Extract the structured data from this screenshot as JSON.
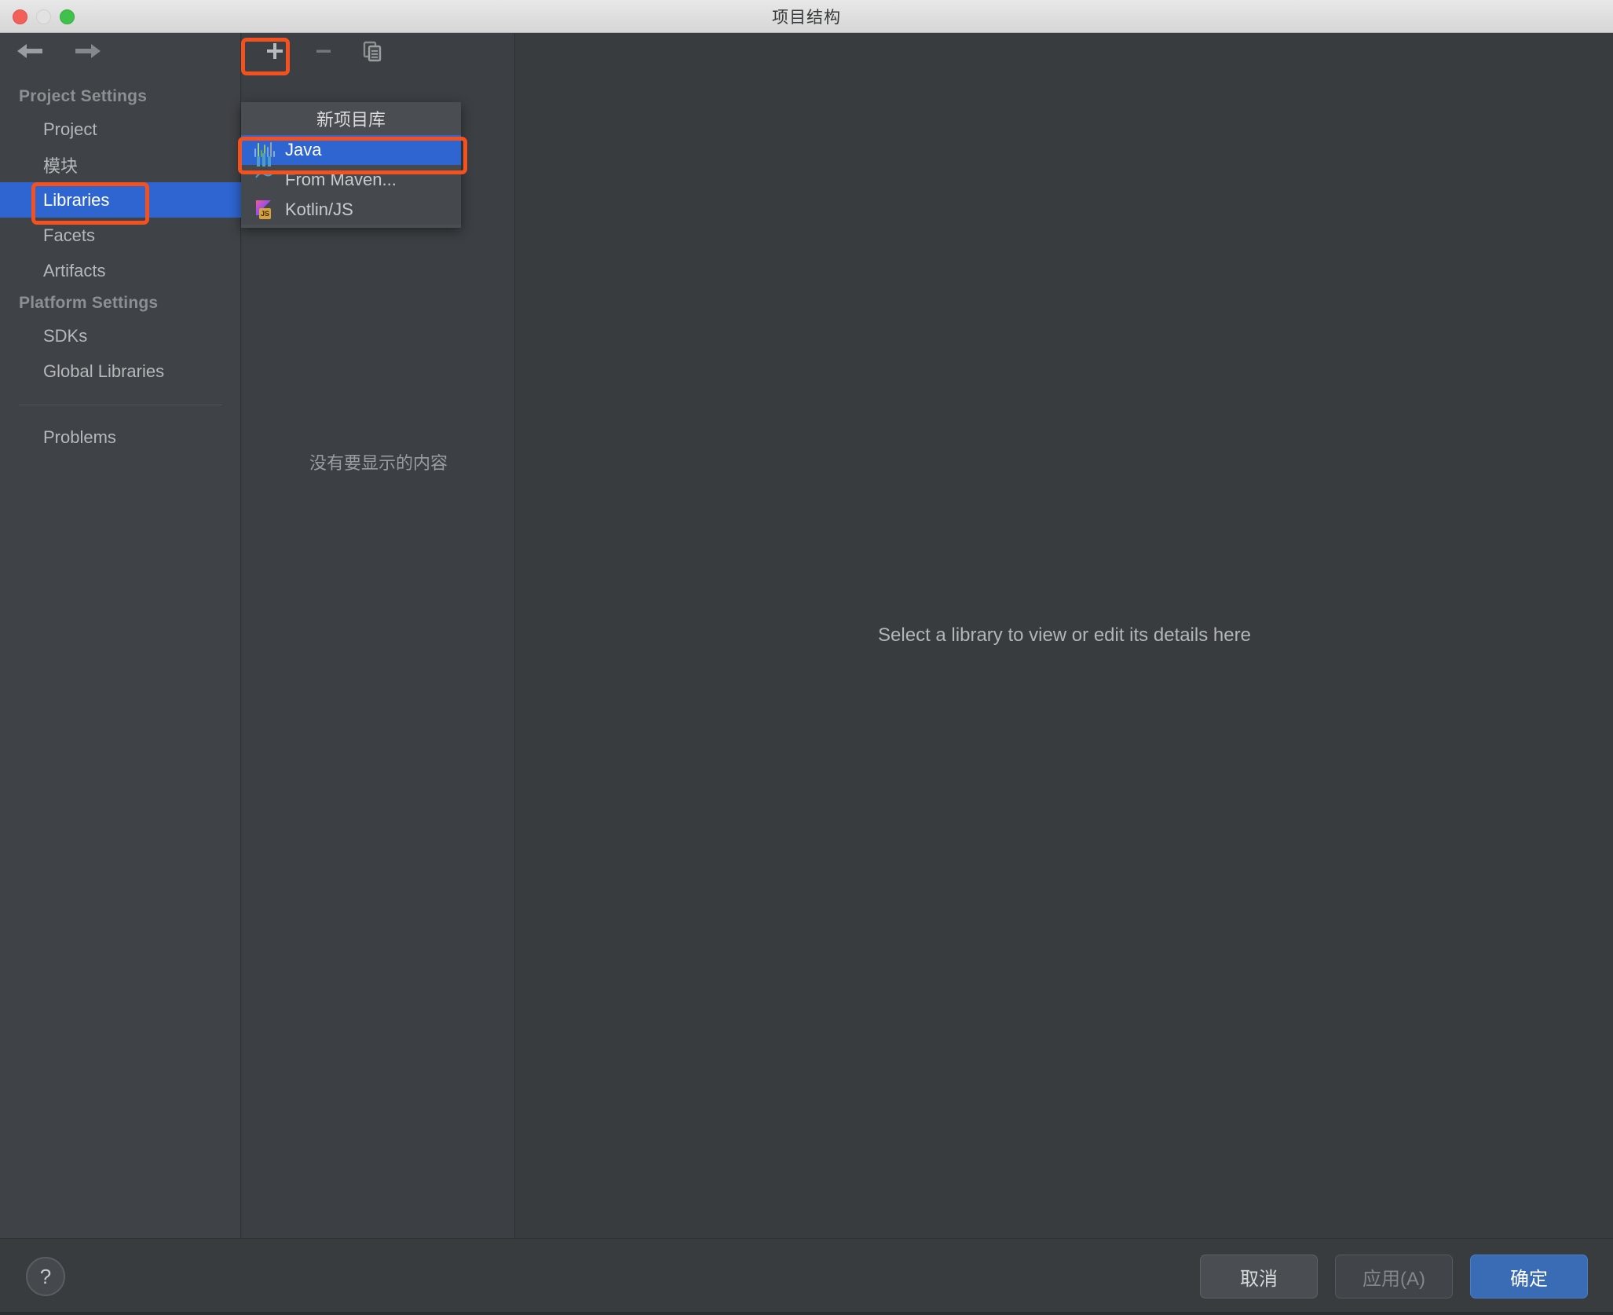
{
  "window": {
    "title": "项目结构",
    "controls": {
      "close": "close-button",
      "minimize": "minimize-button",
      "maximize": "maximize-button"
    }
  },
  "navigation": {
    "back_label": "",
    "forward_label": ""
  },
  "sidebar": {
    "groups": [
      {
        "header": "Project Settings",
        "items": [
          {
            "label": "Project",
            "selected": false
          },
          {
            "label": "模块",
            "selected": false
          },
          {
            "label": "Libraries",
            "selected": true
          },
          {
            "label": "Facets",
            "selected": false
          },
          {
            "label": "Artifacts",
            "selected": false
          }
        ]
      },
      {
        "header": "Platform Settings",
        "items": [
          {
            "label": "SDKs",
            "selected": false
          },
          {
            "label": "Global Libraries",
            "selected": false
          }
        ]
      }
    ],
    "problems": {
      "label": "Problems"
    }
  },
  "center_panel": {
    "toolbar": {
      "add_label": "+",
      "remove_label": "−",
      "copy_label": "copy"
    },
    "empty_text": "没有要显示的内容"
  },
  "menu": {
    "title": "新项目库",
    "items": [
      {
        "label": "Java",
        "icon": "java-icon",
        "selected": true
      },
      {
        "label": "From Maven...",
        "icon": "maven-icon",
        "selected": false
      },
      {
        "label": "Kotlin/JS",
        "icon": "kotlin-js-icon",
        "selected": false
      }
    ]
  },
  "right_panel": {
    "empty_text": "Select a library to view or edit its details here"
  },
  "footer": {
    "help_label": "?",
    "cancel_label": "取消",
    "apply_label": "应用(A)",
    "ok_label": "确定"
  },
  "colors": {
    "accent_selection": "#2f65d0",
    "annotation": "#f4511e",
    "primary_button": "#3a6bb5",
    "window_bg": "#393c3f",
    "sidebar_bg": "#3f4246"
  },
  "annotations": [
    {
      "name": "libraries-sidebar-highlight"
    },
    {
      "name": "add-button-highlight"
    },
    {
      "name": "java-menu-item-highlight"
    }
  ]
}
